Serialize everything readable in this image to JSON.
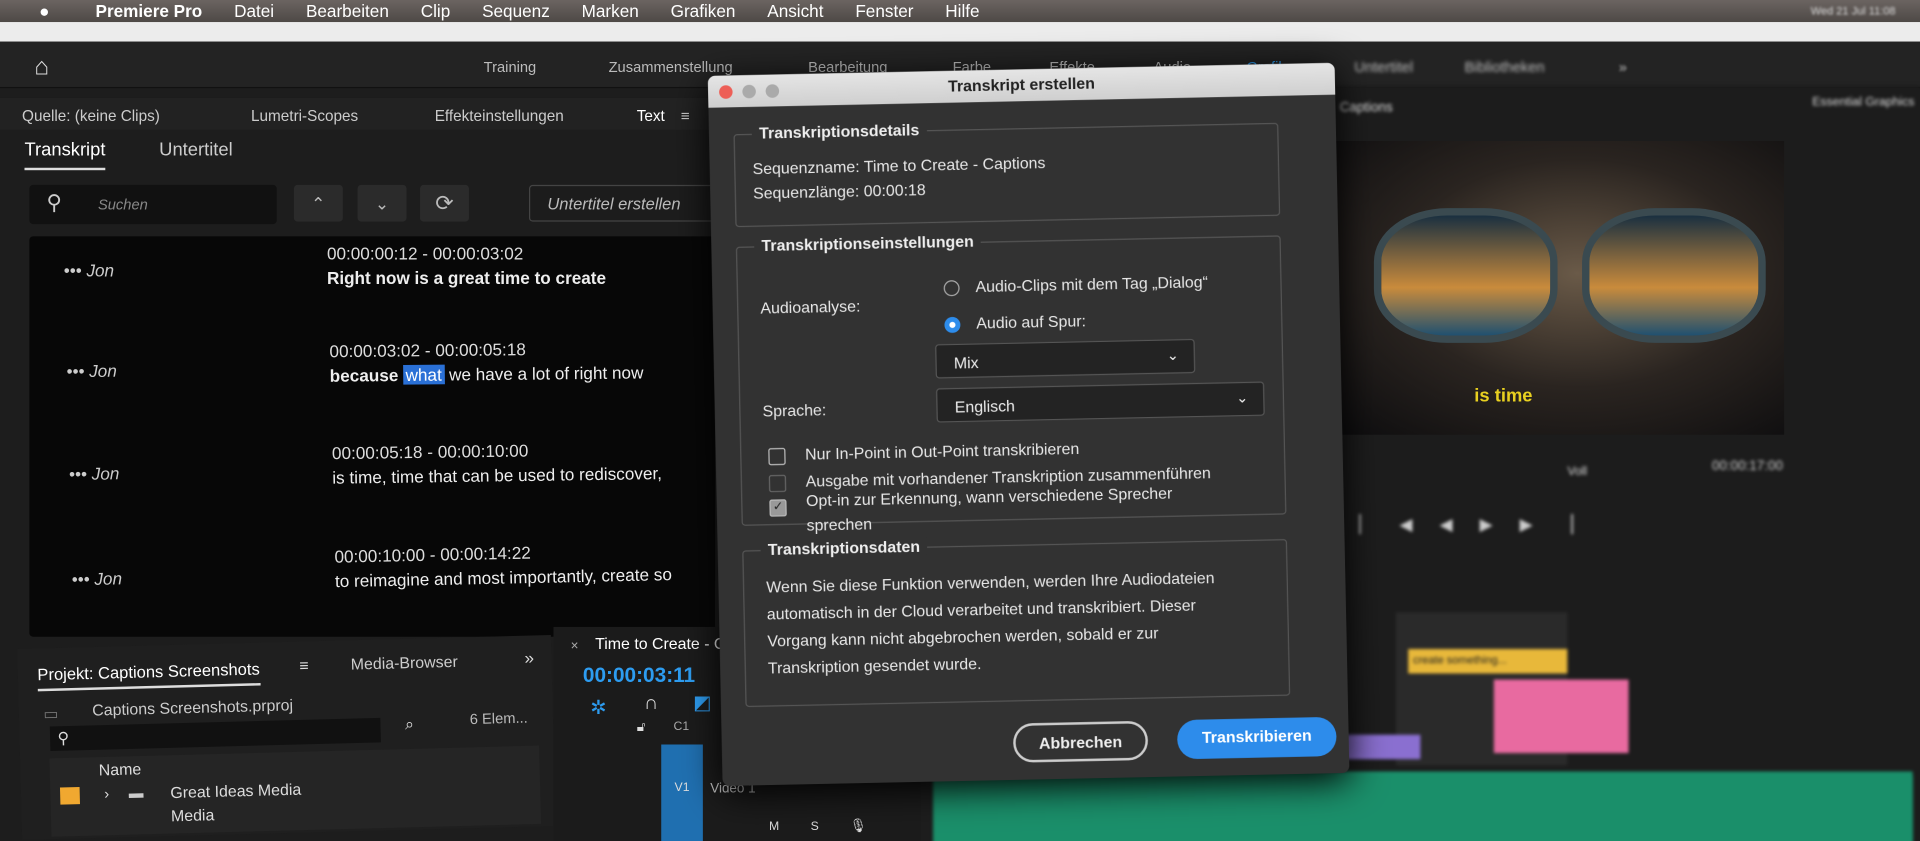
{
  "menubar": {
    "apple": "",
    "app": "Premiere Pro",
    "items": [
      "Datei",
      "Bearbeiten",
      "Clip",
      "Sequenz",
      "Marken",
      "Grafiken",
      "Ansicht",
      "Fenster",
      "Hilfe"
    ],
    "clock": "Wed 21 Jul 11:08"
  },
  "workspaces": {
    "items": [
      "Training",
      "Zusammenstellung",
      "Bearbeitung",
      "Farbe",
      "Effekte",
      "Audio",
      "Grafiken",
      "Untertitel",
      "Bibliotheken"
    ],
    "active": "Grafiken",
    "more": "»"
  },
  "source_panel": {
    "tabs": [
      "Quelle: (keine Clips)",
      "Lumetri-Scopes",
      "Effekteinstellungen",
      "Text"
    ],
    "menu": "≡"
  },
  "text_panel": {
    "tabs": [
      "Transkript",
      "Untertitel"
    ],
    "search_placeholder": "Suchen",
    "up": "⌃",
    "down": "⌄",
    "refresh": "⟳",
    "create_captions": "Untertitel erstellen"
  },
  "transcript": [
    {
      "speaker": "Jon",
      "timecode": "00:00:00:12 - 00:00:03:02",
      "text": "Right now is a great time to create"
    },
    {
      "speaker": "Jon",
      "timecode": "00:00:03:02 - 00:00:05:18",
      "pre": "because ",
      "highlight": "what",
      "post": " we have a lot of right now"
    },
    {
      "speaker": "Jon",
      "timecode": "00:00:05:18 - 00:00:10:00",
      "text": "is time, time that can be used to rediscover,"
    },
    {
      "speaker": "Jon",
      "timecode": "00:00:10:00 - 00:00:14:22",
      "text": "to reimagine and most importantly, create so"
    }
  ],
  "project": {
    "tab": "Projekt: Captions Screenshots",
    "menu": "≡",
    "tab2": "Media-Browser",
    "more": "»",
    "file": "Captions Screenshots.prproj",
    "count": "6 Elem...",
    "col_name": "Name",
    "rows": [
      "Great Ideas Media",
      "Media"
    ]
  },
  "timeline": {
    "close": "×",
    "title": "Time to Create - Ca",
    "timecode": "00:00:03:11",
    "track_c1": "C1",
    "track_v1": "V1",
    "track_label": "Video 1",
    "m": "M",
    "s": "S"
  },
  "dialog": {
    "title": "Transkript erstellen",
    "details": {
      "label": "Transkriptionsdetails",
      "name_label": "Sequenzname:",
      "name": "Time to Create - Captions",
      "length_label": "Sequenzlänge:",
      "length": "00:00:18"
    },
    "settings": {
      "label": "Transkriptionseinstellungen",
      "audio_label": "Audioanalyse:",
      "opt1": "Audio-Clips mit dem Tag „Dialog“",
      "opt2": "Audio auf Spur:",
      "track": "Mix",
      "lang_label": "Sprache:",
      "lang": "Englisch",
      "chk1": "Nur In-Point in Out-Point transkribieren",
      "chk2": "Ausgabe mit vorhandener Transkription zusammenführen",
      "chk3a": "Opt-in zur Erkennung, wann verschiedene Sprecher",
      "chk3b": "sprechen"
    },
    "data": {
      "label": "Transkriptionsdaten",
      "lines": [
        "Wenn Sie diese Funktion verwenden, werden Ihre Audiodateien",
        "automatisch in der Cloud verarbeitet und transkribiert. Dieser",
        "Vorgang kann nicht abgebrochen werden, sobald er zur",
        "Transkription gesendet wurde."
      ]
    },
    "cancel": "Abbrechen",
    "ok": "Transkribieren"
  },
  "program": {
    "tab": "Captions",
    "caption": "is time",
    "timecode": "00:00:17:00",
    "fit": "Voll"
  },
  "essential": {
    "title": "Essential Graphics"
  },
  "clips": [
    "create something..."
  ],
  "colors": {
    "accent": "#2d8ceb",
    "highlight": "#2a70d6",
    "timecode": "#2d9cf0",
    "caption": "#e8d020",
    "label_orange": "#f0a830",
    "pink": "#e86aa0"
  }
}
